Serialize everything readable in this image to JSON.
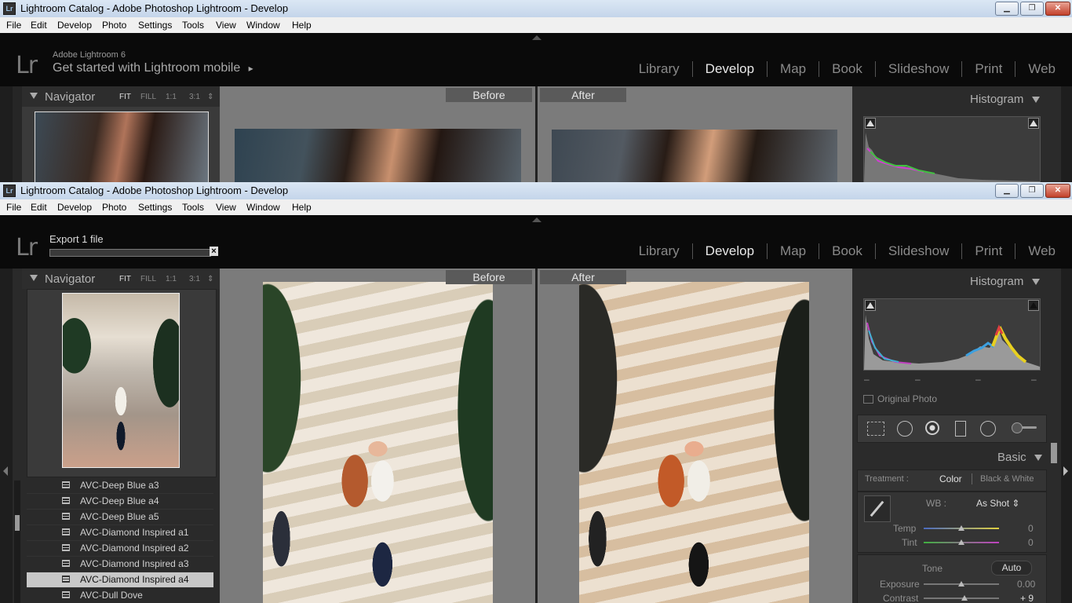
{
  "window": {
    "title": "Lightroom Catalog - Adobe Photoshop Lightroom - Develop",
    "badge": "Lr",
    "buttons": {
      "minimize": "▁",
      "restore": "❐",
      "close": "✕"
    }
  },
  "menu": [
    "File",
    "Edit",
    "Develop",
    "Photo",
    "Settings",
    "Tools",
    "View",
    "Window",
    "Help"
  ],
  "identity": {
    "logo": "Lr",
    "product": "Adobe Lightroom 6",
    "mobile_prompt": "Get started with Lightroom mobile",
    "mobile_arrow": "▸"
  },
  "export": {
    "label": "Export 1 file",
    "cancel": "×"
  },
  "modules": [
    "Library",
    "Develop",
    "Map",
    "Book",
    "Slideshow",
    "Print",
    "Web"
  ],
  "active_module": "Develop",
  "navigator": {
    "title": "Navigator",
    "zoom_options": [
      "FIT",
      "FILL",
      "1:1",
      "3:1"
    ],
    "zoom_selected": "FIT",
    "zoom_stepper": "⇕"
  },
  "compare": {
    "before": "Before",
    "after": "After"
  },
  "histogram": {
    "title": "Histogram",
    "original_photo": "Original Photo",
    "clip_marks": [
      "–",
      "–",
      "–",
      "–"
    ]
  },
  "basic": {
    "title": "Basic",
    "treatment_label": "Treatment :",
    "treatment_color": "Color",
    "treatment_bw": "Black & White",
    "wb_label": "WB :",
    "wb_value": "As Shot ⇕",
    "temp_label": "Temp",
    "temp_value": "0",
    "tint_label": "Tint",
    "tint_value": "0",
    "tone_label": "Tone",
    "auto_label": "Auto",
    "exposure_label": "Exposure",
    "exposure_value": "0.00",
    "contrast_label": "Contrast",
    "contrast_value": "+ 9"
  },
  "presets": [
    "AVC-Deep Blue a3",
    "AVC-Deep Blue a4",
    "AVC-Deep Blue a5",
    "AVC-Diamond Inspired a1",
    "AVC-Diamond Inspired a2",
    "AVC-Diamond Inspired a3",
    "AVC-Diamond Inspired a4",
    "AVC-Dull Dove"
  ],
  "selected_preset": "AVC-Diamond Inspired a4",
  "colors": {
    "panel_bg": "#3a3a3a",
    "center_bg": "#7b7b7b",
    "selected_row": "#c8c8c8",
    "active_module": "#e8e8e8"
  },
  "icons": [
    "crop-overlay-icon",
    "spot-removal-icon",
    "red-eye-icon",
    "graduated-filter-icon",
    "radial-filter-icon",
    "adjustment-brush-icon",
    "eyedropper-icon"
  ]
}
